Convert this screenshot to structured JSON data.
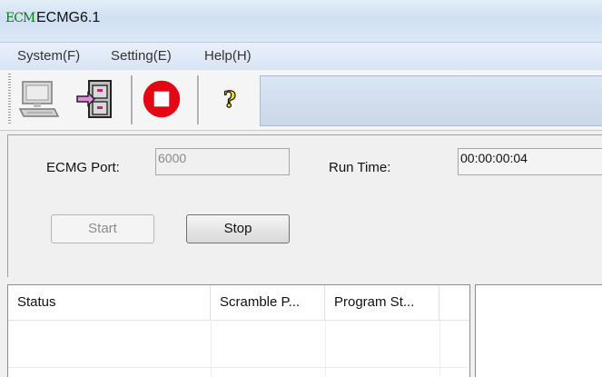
{
  "window": {
    "icon_text": "ECM",
    "title": "ECMG6.1"
  },
  "menu": {
    "items": [
      "System(F)",
      "Setting(E)",
      "Help(H)"
    ]
  },
  "toolbar": {
    "buttons": [
      "computer-icon",
      "filing-cabinet-icon",
      "stop-icon",
      "help-icon"
    ]
  },
  "form": {
    "port_label": "ECMG Port:",
    "port_value": "6000",
    "runtime_label": "Run Time:",
    "runtime_value": "00:00:00:04",
    "start_label": "Start",
    "stop_label": "Stop"
  },
  "table": {
    "columns": [
      "Status",
      "Scramble P...",
      "Program St...",
      ""
    ],
    "rows": []
  },
  "colors": {
    "stop_red": "#e30613",
    "title_green": "#0a7a1a"
  }
}
